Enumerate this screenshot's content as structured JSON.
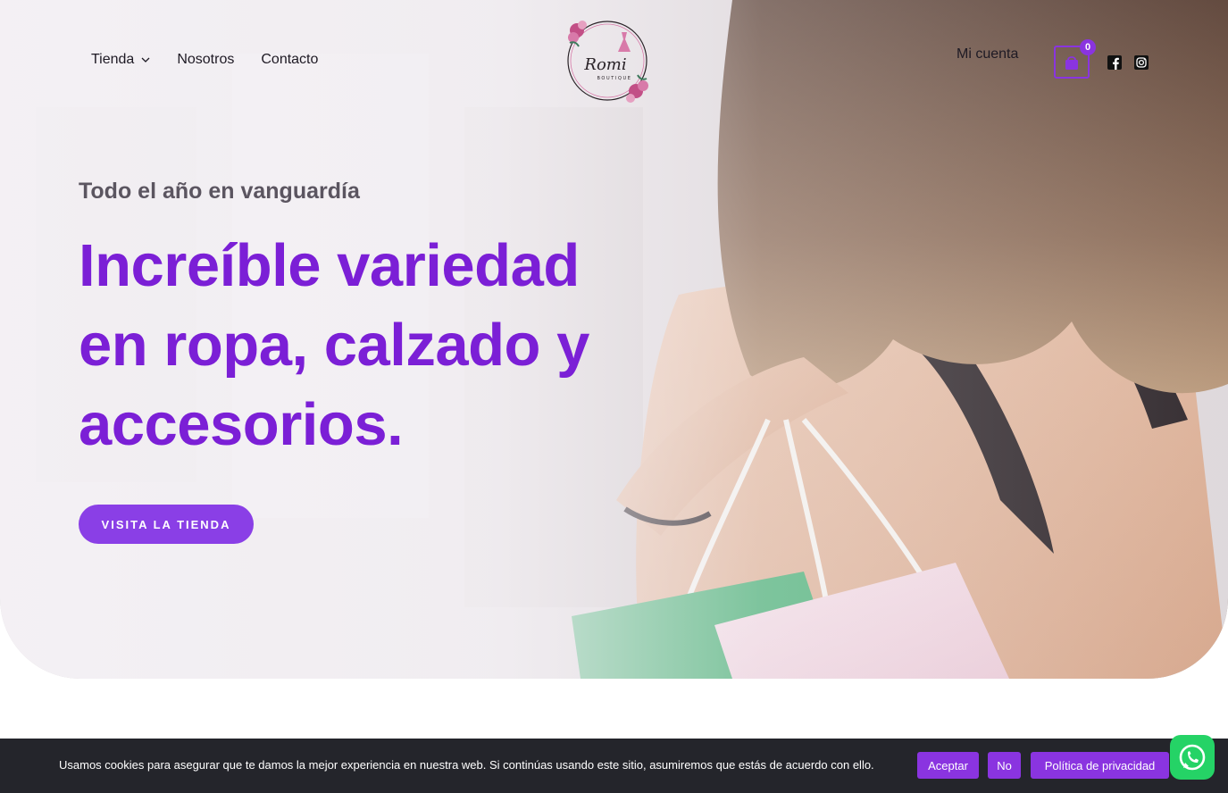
{
  "header": {
    "nav_left": [
      {
        "label": "Tienda",
        "has_dropdown": true
      },
      {
        "label": "Nosotros"
      },
      {
        "label": "Contacto"
      }
    ],
    "logo": {
      "brand": "Romi",
      "tagline": "BOUTIQUE"
    },
    "account_label": "Mi cuenta",
    "cart": {
      "count": "0",
      "icon": "shopping-bag-icon"
    },
    "social": [
      {
        "icon": "facebook-icon"
      },
      {
        "icon": "instagram-icon"
      }
    ]
  },
  "hero": {
    "eyebrow": "Todo el año en vanguardía",
    "headline_lines": [
      "Increíble variedad",
      "en ropa, calzado y",
      "accesorios."
    ],
    "cta_label": "VISITA LA TIENDA"
  },
  "cookie_bar": {
    "text": "Usamos cookies para asegurar que te damos la mejor experiencia en nuestra web. Si continúas usando este sitio, asumiremos que estás de acuerdo con ello.",
    "accept_label": "Aceptar",
    "no_label": "No",
    "policy_label": "Política de privacidad"
  },
  "whatsapp": {
    "icon": "whatsapp-icon"
  },
  "colors": {
    "accent": "#8a34e0",
    "headline": "#7b1fd6",
    "cookie_bg": "#24252b",
    "whatsapp": "#25d366"
  }
}
